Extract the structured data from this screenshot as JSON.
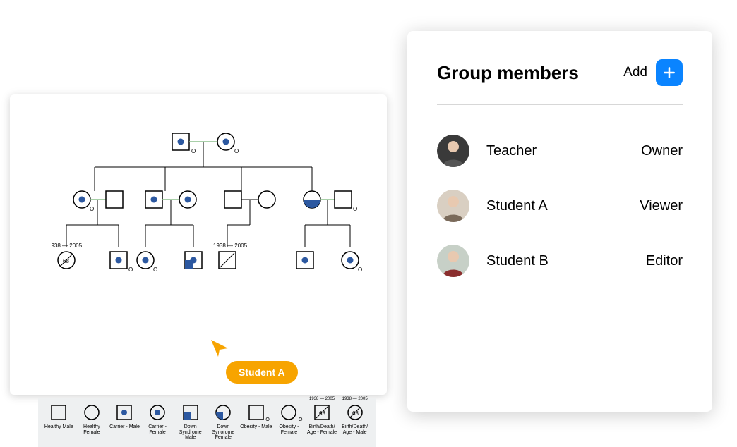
{
  "cursor": {
    "label": "Student A"
  },
  "pedigree": {
    "birth_death_example": {
      "birth": "1938",
      "death": "2005",
      "age": "68"
    }
  },
  "legend": {
    "items": [
      {
        "label": "Healthy Male"
      },
      {
        "label": "Healthy Female"
      },
      {
        "label": "Carrier - Male"
      },
      {
        "label": "Carrier - Female"
      },
      {
        "label": "Down Syndrome Male"
      },
      {
        "label": "Down Synorome Female"
      },
      {
        "label": "Obesity - Male"
      },
      {
        "label": "Obesity - Female"
      },
      {
        "label": "Birth/Death/ Age - Female",
        "birth": "1938",
        "death": "2005",
        "age": "68"
      },
      {
        "label": "Birth/Death/ Age - Male",
        "birth": "1938",
        "death": "2005",
        "age": "68"
      }
    ]
  },
  "group_members": {
    "title": "Group members",
    "add_label": "Add",
    "members": [
      {
        "name": "Teacher",
        "role": "Owner"
      },
      {
        "name": "Student A",
        "role": "Viewer"
      },
      {
        "name": "Student B",
        "role": "Editor"
      }
    ]
  }
}
